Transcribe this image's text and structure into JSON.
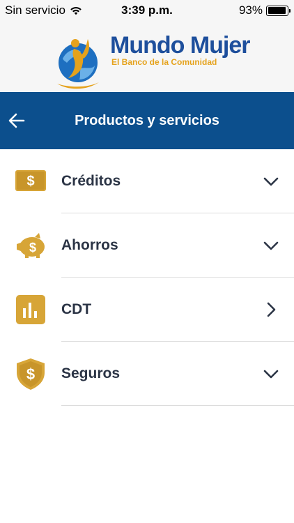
{
  "status_bar": {
    "carrier": "Sin servicio",
    "time": "3:39 p.m.",
    "battery": "93%",
    "battery_level": 0.93
  },
  "brand": {
    "name": "Mundo Mujer",
    "tagline": "El Banco de la Comunidad",
    "primary_color": "#1e4f9c",
    "accent_color": "#e5a21c"
  },
  "nav": {
    "title": "Productos y servicios",
    "back_icon": "arrow-left-icon",
    "bar_color": "#0c4f8d"
  },
  "products": [
    {
      "label": "Créditos",
      "icon": "money-bill-icon",
      "chevron": "chevron-down-icon"
    },
    {
      "label": "Ahorros",
      "icon": "piggy-bank-icon",
      "chevron": "chevron-down-icon"
    },
    {
      "label": "CDT",
      "icon": "bar-chart-icon",
      "chevron": "chevron-right-icon"
    },
    {
      "label": "Seguros",
      "icon": "shield-dollar-icon",
      "chevron": "chevron-down-icon"
    }
  ],
  "icon_color": "#d7a537"
}
